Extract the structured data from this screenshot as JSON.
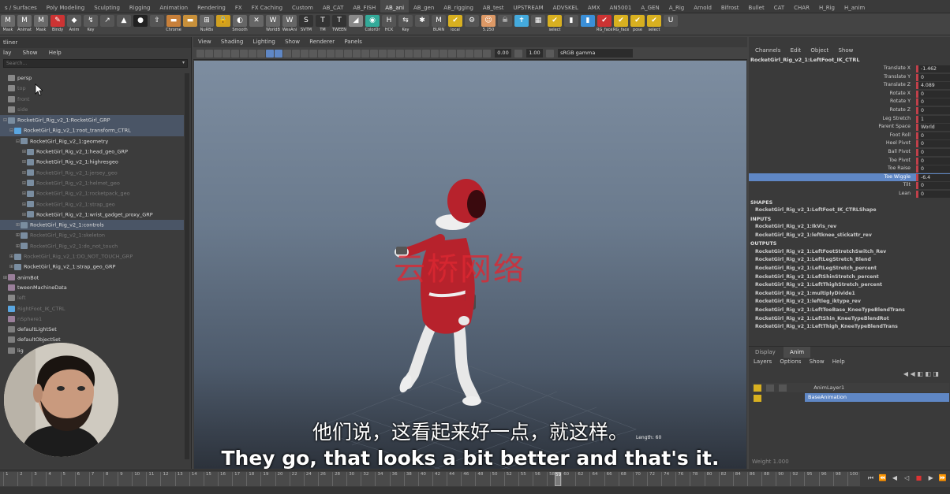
{
  "shelf": {
    "tabs": [
      {
        "label": "s / Surfaces",
        "active": false
      },
      {
        "label": "Poly Modeling",
        "active": false
      },
      {
        "label": "Sculpting",
        "active": false
      },
      {
        "label": "Rigging",
        "active": false
      },
      {
        "label": "Animation",
        "active": false
      },
      {
        "label": "Rendering",
        "active": false
      },
      {
        "label": "FX",
        "active": false
      },
      {
        "label": "FX Caching",
        "active": false
      },
      {
        "label": "Custom",
        "active": false
      },
      {
        "label": "AB_CAT",
        "active": false
      },
      {
        "label": "AB_FISH",
        "active": false
      },
      {
        "label": "AB_ani",
        "active": true
      },
      {
        "label": "AB_gen",
        "active": false
      },
      {
        "label": "AB_rigging",
        "active": false
      },
      {
        "label": "AB_test",
        "active": false
      },
      {
        "label": "UPSTREAM",
        "active": false
      },
      {
        "label": "ADVSKEL",
        "active": false
      },
      {
        "label": "AMX",
        "active": false
      },
      {
        "label": "AN5001",
        "active": false
      },
      {
        "label": "A_GEN",
        "active": false
      },
      {
        "label": "A_Rig",
        "active": false
      },
      {
        "label": "Arnold",
        "active": false
      },
      {
        "label": "Bifrost",
        "active": false
      },
      {
        "label": "Bullet",
        "active": false
      },
      {
        "label": "CAT",
        "active": false
      },
      {
        "label": "CHAR",
        "active": false
      },
      {
        "label": "H_Rig",
        "active": false
      },
      {
        "label": "H_anim",
        "active": false
      }
    ],
    "buttons": [
      {
        "label": "Mask",
        "glyph": "M",
        "color": "#6a6a6a"
      },
      {
        "label": "Animat",
        "glyph": "M",
        "color": "#6a6a6a"
      },
      {
        "label": "Mask",
        "glyph": "M",
        "color": "#6a6a6a"
      },
      {
        "label": "Bindy",
        "glyph": "✎",
        "color": "#c33"
      },
      {
        "label": "Anim",
        "glyph": "◆",
        "color": "#5a5a5a"
      },
      {
        "label": "Key",
        "glyph": "↯",
        "color": "#5a5a5a"
      },
      {
        "label": "",
        "glyph": "↗",
        "color": "#555"
      },
      {
        "label": "",
        "glyph": "▲",
        "color": "#555"
      },
      {
        "label": "",
        "glyph": "●",
        "color": "#222"
      },
      {
        "label": "",
        "glyph": "⇧",
        "color": "#555"
      },
      {
        "label": "Chrome",
        "glyph": "▬",
        "color": "#c8803a"
      },
      {
        "label": "",
        "glyph": "▬",
        "color": "#c8903a"
      },
      {
        "label": "NuRBs",
        "glyph": "⊞",
        "color": "#666"
      },
      {
        "label": "",
        "glyph": "🔒",
        "color": "#d0a020"
      },
      {
        "label": "Smooth",
        "glyph": "◐",
        "color": "#666"
      },
      {
        "label": "",
        "glyph": "✕",
        "color": "#666"
      },
      {
        "label": "WorldB",
        "glyph": "W",
        "color": "#666"
      },
      {
        "label": "WesAni",
        "glyph": "W",
        "color": "#666"
      },
      {
        "label": "SVTM",
        "glyph": "S",
        "color": "#333"
      },
      {
        "label": "TM",
        "glyph": "T",
        "color": "#333"
      },
      {
        "label": "TWEEN",
        "glyph": "T",
        "color": "#333"
      },
      {
        "label": "",
        "glyph": "◢",
        "color": "#888"
      },
      {
        "label": "ColorOr",
        "glyph": "◉",
        "color": "#3a9"
      },
      {
        "label": "HCK",
        "glyph": "H",
        "color": "#555"
      },
      {
        "label": "Key",
        "glyph": "⇆",
        "color": "#555"
      },
      {
        "label": "",
        "glyph": "✱",
        "color": "#555"
      },
      {
        "label": "BURN",
        "glyph": "M",
        "color": "#555"
      },
      {
        "label": "local",
        "glyph": "✔",
        "color": "#d8b020"
      },
      {
        "label": "",
        "glyph": "⚙",
        "color": "#555"
      },
      {
        "label": "5.250",
        "glyph": "☺",
        "color": "#d96"
      },
      {
        "label": "",
        "glyph": "☠",
        "color": "#555"
      },
      {
        "label": "",
        "glyph": "✝",
        "color": "#4ad"
      },
      {
        "label": "",
        "glyph": "▦",
        "color": "#555"
      },
      {
        "label": "select",
        "glyph": "✔",
        "color": "#d8b020"
      },
      {
        "label": "",
        "glyph": "▮",
        "color": "#555"
      },
      {
        "label": "",
        "glyph": "▮",
        "color": "#3a8fd8"
      },
      {
        "label": "RG_face",
        "glyph": "✔",
        "color": "#c33"
      },
      {
        "label": "RG_face",
        "glyph": "✔",
        "color": "#d8b020"
      },
      {
        "label": "pose",
        "glyph": "✔",
        "color": "#d8b020"
      },
      {
        "label": "select",
        "glyph": "✔",
        "color": "#d8b020"
      },
      {
        "label": "",
        "glyph": "U",
        "color": "#555"
      }
    ]
  },
  "outliner": {
    "title": "tliner",
    "menu": [
      "lay",
      "Show",
      "Help"
    ],
    "search_placeholder": "Search...",
    "rows": [
      {
        "label": "persp",
        "indent": 0,
        "icon": "camera",
        "color": "#bbb",
        "dim": false,
        "sel": false,
        "exp": ""
      },
      {
        "label": "top",
        "indent": 0,
        "icon": "camera",
        "color": "#bbb",
        "dim": true,
        "sel": false,
        "exp": ""
      },
      {
        "label": "front",
        "indent": 0,
        "icon": "camera",
        "color": "#bbb",
        "dim": true,
        "sel": false,
        "exp": ""
      },
      {
        "label": "side",
        "indent": 0,
        "icon": "camera",
        "color": "#bbb",
        "dim": true,
        "sel": false,
        "exp": ""
      },
      {
        "label": "RocketGirl_Rig_v2_1:RocketGirl_GRP",
        "indent": 0,
        "icon": "group",
        "color": "#9ab",
        "dim": false,
        "sel": true,
        "exp": "⊟"
      },
      {
        "label": "RocketGirl_Rig_v2_1:root_transform_CTRL",
        "indent": 1,
        "icon": "curve",
        "color": "#8cf",
        "dim": false,
        "sel": true,
        "exp": "⊟"
      },
      {
        "label": "RocketGirl_Rig_v2_1:geometry",
        "indent": 2,
        "icon": "group",
        "color": "#9ab",
        "dim": false,
        "sel": false,
        "exp": "⊟"
      },
      {
        "label": "RocketGirl_Rig_v2_1:head_geo_GRP",
        "indent": 3,
        "icon": "group",
        "color": "#9ab",
        "dim": false,
        "sel": false,
        "exp": "⊞"
      },
      {
        "label": "RocketGirl_Rig_v2_1:highresgeo",
        "indent": 3,
        "icon": "group",
        "color": "#9ab",
        "dim": false,
        "sel": false,
        "exp": "⊞"
      },
      {
        "label": "RocketGirl_Rig_v2_1:jersey_geo",
        "indent": 3,
        "icon": "group",
        "color": "#9ab",
        "dim": true,
        "sel": false,
        "exp": "⊞"
      },
      {
        "label": "RocketGirl_Rig_v2_1:helmet_geo",
        "indent": 3,
        "icon": "group",
        "color": "#9ab",
        "dim": true,
        "sel": false,
        "exp": "⊞"
      },
      {
        "label": "RocketGirl_Rig_v2_1:rocketpack_geo",
        "indent": 3,
        "icon": "group",
        "color": "#9ab",
        "dim": true,
        "sel": false,
        "exp": "⊞"
      },
      {
        "label": "RocketGirl_Rig_v2_1:strap_geo",
        "indent": 3,
        "icon": "group",
        "color": "#9ab",
        "dim": true,
        "sel": false,
        "exp": "⊞"
      },
      {
        "label": "RocketGirl_Rig_v2_1:wrist_gadget_proxy_GRP",
        "indent": 3,
        "icon": "group",
        "color": "#9ab",
        "dim": false,
        "sel": false,
        "exp": "⊞"
      },
      {
        "label": "RocketGirl_Rig_v2_1:controls",
        "indent": 2,
        "icon": "group",
        "color": "#9ab",
        "dim": false,
        "sel": true,
        "exp": "⊞"
      },
      {
        "label": "RocketGirl_Rig_v2_1:skeleton",
        "indent": 2,
        "icon": "group",
        "color": "#9ab",
        "dim": true,
        "sel": false,
        "exp": "⊞"
      },
      {
        "label": "RocketGirl_Rig_v2_1:do_not_touch",
        "indent": 2,
        "icon": "group",
        "color": "#9ab",
        "dim": true,
        "sel": false,
        "exp": "⊞"
      },
      {
        "label": "RocketGirl_Rig_v2_1:DO_NOT_TOUCH_GRP",
        "indent": 1,
        "icon": "group",
        "color": "#9ab",
        "dim": true,
        "sel": false,
        "exp": "⊞"
      },
      {
        "label": "RocketGirl_Rig_v2_1:strap_geo_GRP",
        "indent": 1,
        "icon": "group",
        "color": "#9ab",
        "dim": false,
        "sel": false,
        "exp": "⊞"
      },
      {
        "label": "animBot",
        "indent": 0,
        "icon": "box",
        "color": "#c9a",
        "dim": false,
        "sel": false,
        "exp": "⊞"
      },
      {
        "label": "tweenMachineData",
        "indent": 0,
        "icon": "box",
        "color": "#aaa",
        "dim": false,
        "sel": false,
        "exp": ""
      },
      {
        "label": "left",
        "indent": 0,
        "icon": "camera",
        "color": "#bbb",
        "dim": true,
        "sel": false,
        "exp": ""
      },
      {
        "label": "RightFoot_IK_CTRL",
        "indent": 0,
        "icon": "curve",
        "color": "#8cf",
        "dim": true,
        "sel": false,
        "exp": ""
      },
      {
        "label": "nSphere1",
        "indent": 0,
        "icon": "box",
        "color": "#aaa",
        "dim": true,
        "sel": false,
        "exp": ""
      },
      {
        "label": "defaultLightSet",
        "indent": 0,
        "icon": "set",
        "color": "#bbb",
        "dim": false,
        "sel": false,
        "exp": ""
      },
      {
        "label": "defaultObjectSet",
        "indent": 0,
        "icon": "set",
        "color": "#bbb",
        "dim": false,
        "sel": false,
        "exp": ""
      },
      {
        "label": "lig",
        "indent": 0,
        "icon": "set",
        "color": "#bbb",
        "dim": false,
        "sel": false,
        "exp": ""
      }
    ]
  },
  "viewport": {
    "menu": [
      "View",
      "Shading",
      "Lighting",
      "Show",
      "Renderer",
      "Panels"
    ],
    "field_a": "0.00",
    "field_b": "1.00",
    "colorspace": "sRGB gamma",
    "frame_info": "Length: 60",
    "watermark": "云桥网络",
    "subtitle_cn": "他们说，这看起来好一点，就这样。",
    "subtitle_en": "They go, that looks a bit better and that's it."
  },
  "channelbox": {
    "menu": [
      "Channels",
      "Edit",
      "Object",
      "Show"
    ],
    "title": "RocketGirl_Rig_v2_1:LeftFoot_IK_CTRL",
    "attributes": [
      {
        "name": "Translate X",
        "value": "-1.462",
        "hl": false
      },
      {
        "name": "Translate Y",
        "value": "0",
        "hl": false
      },
      {
        "name": "Translate Z",
        "value": "4.089",
        "hl": false
      },
      {
        "name": "Rotate X",
        "value": "0",
        "hl": false
      },
      {
        "name": "Rotate Y",
        "value": "0",
        "hl": false
      },
      {
        "name": "Rotate Z",
        "value": "0",
        "hl": false
      },
      {
        "name": "Leg Stretch",
        "value": "1",
        "hl": false
      },
      {
        "name": "Parent Space",
        "value": "World",
        "hl": false
      },
      {
        "name": "Foot Roll",
        "value": "0",
        "hl": false
      },
      {
        "name": "Heel Pivot",
        "value": "0",
        "hl": false
      },
      {
        "name": "Ball Pivot",
        "value": "0",
        "hl": false
      },
      {
        "name": "Toe Pivot",
        "value": "0",
        "hl": false
      },
      {
        "name": "Toe Raise",
        "value": "0",
        "hl": false
      },
      {
        "name": "Toe Wiggle",
        "value": "-6.4",
        "hl": true
      },
      {
        "name": "Tilt",
        "value": "0",
        "hl": false
      },
      {
        "name": "Lean",
        "value": "0",
        "hl": false
      }
    ],
    "shapes_label": "SHAPES",
    "shapes": [
      "RocketGirl_Rig_v2_1:LeftFoot_IK_CTRLShape"
    ],
    "inputs_label": "INPUTS",
    "inputs": [
      "RocketGirl_Rig_v2_1:IkVis_rev",
      "RocketGirl_Rig_v2_1:leftknee_stickattr_rev"
    ],
    "outputs_label": "OUTPUTS",
    "outputs": [
      "RocketGirl_Rig_v2_1:LeftFootStretchSwitch_Rev",
      "RocketGirl_Rig_v2_1:LeftLegStretch_Blend",
      "RocketGirl_Rig_v2_1:LeftLegStretch_percent",
      "RocketGirl_Rig_v2_1:LeftShinStretch_percent",
      "RocketGirl_Rig_v2_1:LeftThighStretch_percent",
      "RocketGirl_Rig_v2_1:multiplyDivide1",
      "RocketGirl_Rig_v2_1:leftleg_iktype_rev",
      "RocketGirl_Rig_v2_1:LeftToeBase_KneeTypeBlendTrans",
      "RocketGirl_Rig_v2_1:LeftShin_KneeTypeBlendRot",
      "RocketGirl_Rig_v2_1:LeftThigh_KneeTypeBlendTrans"
    ]
  },
  "layers": {
    "tabs": [
      {
        "label": "Display",
        "active": false
      },
      {
        "label": "Anim",
        "active": true
      }
    ],
    "menu": [
      "Layers",
      "Options",
      "Show",
      "Help"
    ],
    "anim_layer": "AnimLayer1",
    "base_layer": "BaseAnimation",
    "weight_label": "Weight",
    "weight_value": "1.000"
  },
  "timeline": {
    "ticks": [
      "1",
      "2",
      "3",
      "4",
      "5",
      "6",
      "7",
      "8",
      "9",
      "10",
      "11",
      "12",
      "13",
      "14",
      "15",
      "16",
      "17",
      "18",
      "19",
      "20",
      "22",
      "24",
      "26",
      "28",
      "30",
      "32",
      "34",
      "36",
      "38",
      "40",
      "42",
      "44",
      "46",
      "48",
      "50",
      "52",
      "55",
      "56",
      "58",
      "60",
      "62",
      "64",
      "66",
      "68",
      "70",
      "72",
      "74",
      "76",
      "78",
      "80",
      "82",
      "84",
      "86",
      "88",
      "90",
      "92",
      "95",
      "96",
      "98",
      "100"
    ],
    "current_frame": "59",
    "current_frame_index": 38
  }
}
